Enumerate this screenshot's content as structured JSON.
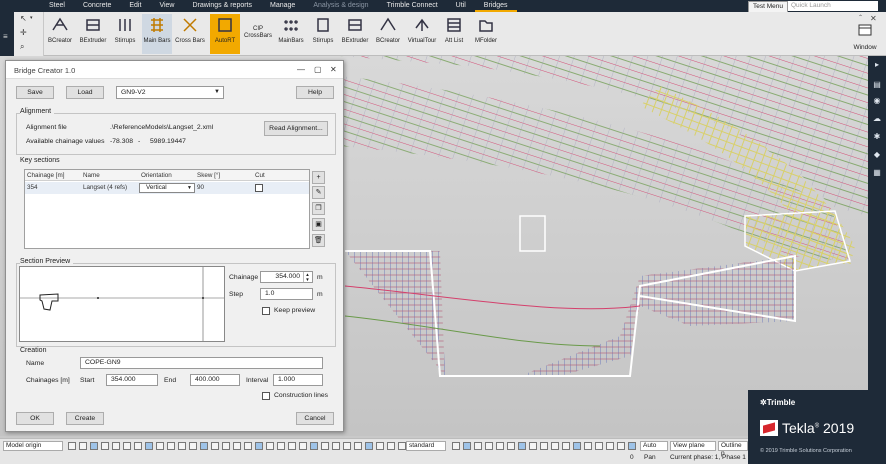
{
  "top_menu": {
    "items": [
      {
        "label": "Steel",
        "state": "normal"
      },
      {
        "label": "Concrete",
        "state": "normal"
      },
      {
        "label": "Edit",
        "state": "normal"
      },
      {
        "label": "View",
        "state": "normal"
      },
      {
        "label": "Drawings & reports",
        "state": "normal"
      },
      {
        "label": "Manage",
        "state": "normal"
      },
      {
        "label": "Analysis & design",
        "state": "dim"
      },
      {
        "label": "Trimble Connect",
        "state": "normal"
      },
      {
        "label": "Util",
        "state": "normal"
      },
      {
        "label": "Bridges",
        "state": "active"
      }
    ],
    "test_menu": "Test Menu",
    "quick_launch_placeholder": "Quick Launch"
  },
  "ribbon": {
    "buttons": [
      "BCreator",
      "BExtruder",
      "Stirrups",
      "Main Bars",
      "Cross Bars",
      "AutoRT",
      "CIP\nCrossBars",
      "MainBars",
      "Stirrups",
      "BExtruder",
      "BCreator",
      "VirtualTour",
      "Att List",
      "MFolder"
    ],
    "window_label": "Window"
  },
  "dialog": {
    "title": "Bridge Creator 1.0",
    "save": "Save",
    "load": "Load",
    "preset": "GN9-V2",
    "help": "Help",
    "alignment": {
      "group": "Alignment",
      "file_label": "Alignment file",
      "file_value": ".\\ReferenceModels\\Langset_2.xml",
      "chainage_label": "Available chainage values",
      "chainage_from": "-78.308",
      "dash": "-",
      "chainage_to": "5989.19447",
      "read_button": "Read Alignment..."
    },
    "key_sections": {
      "group": "Key sections",
      "columns": [
        "Chainage [m]",
        "Name",
        "Orientation",
        "Skew [°]",
        "Cut"
      ],
      "row": {
        "chainage": "354",
        "name": "Langset (4 refs)",
        "orientation": "Vertical",
        "skew": "90"
      }
    },
    "section_preview": {
      "group": "Section Preview",
      "chainage_label": "Chainage",
      "chainage_value": "354.000",
      "step_label": "Step",
      "step_value": "1.0",
      "unit": "m",
      "keep_preview": "Keep preview"
    },
    "creation": {
      "group": "Creation",
      "name_label": "Name",
      "name_value": "COPE-GN9",
      "chainages_label": "Chainages [m]",
      "start_label": "Start",
      "start_value": "354.000",
      "end_label": "End",
      "end_value": "400.000",
      "interval_label": "Interval",
      "interval_value": "1.000",
      "construction_lines": "Construction lines"
    },
    "ok": "OK",
    "create": "Create",
    "cancel": "Cancel"
  },
  "statusbar": {
    "origin": "Model origin",
    "standard": "standard",
    "auto": "Auto",
    "view_plane": "View plane",
    "outline": "Outline p",
    "count": "0",
    "mode": "Pan",
    "phase": "Current phase: 1, Phase 1"
  },
  "brand": {
    "trimble": "Trimble",
    "product": "Tekla",
    "version": "2019",
    "copyright": "© 2019 Trimble Solutions Corporation"
  },
  "colors": {
    "accent": "#f2a900",
    "dark": "#1e2a38",
    "red_bar": "#d4406c",
    "green_bar": "#6a9a4a",
    "yellow_bar": "#d8d06a"
  }
}
